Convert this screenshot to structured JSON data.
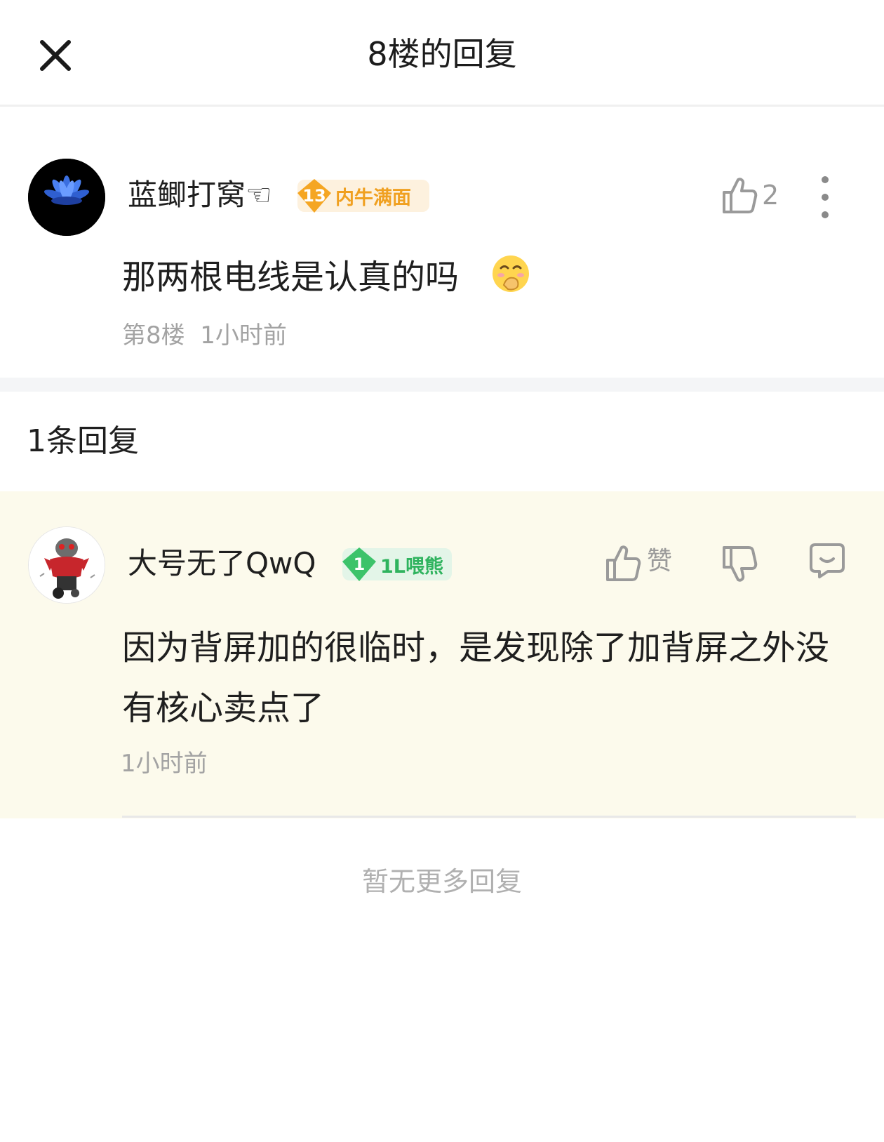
{
  "header": {
    "title": "8楼的回复",
    "close_icon": "close-icon"
  },
  "main_comment": {
    "username": "蓝鲫打窝☜",
    "badge_level": "13",
    "badge_title": "内牛满面",
    "badge_color": "#f5a623",
    "like_count": "2",
    "text": "那两根电线是认真的吗",
    "emoji": "hand-over-mouth-emoji",
    "floor": "第8楼",
    "time": "1小时前",
    "icons": [
      "thumbs-up-icon",
      "more-vertical-icon"
    ]
  },
  "replies_section": {
    "count_label": "1条回复",
    "replies": [
      {
        "username": "大号无了QwQ",
        "badge_level": "1",
        "badge_title": "1L喂熊",
        "badge_color": "#3cc36a",
        "like_label": "赞",
        "text": "因为背屏加的很临时，是发现除了加背屏之外没有核心卖点了",
        "time": "1小时前",
        "icons": [
          "thumbs-up-icon",
          "thumbs-down-icon",
          "reply-icon"
        ]
      }
    ],
    "end_label": "暂无更多回复"
  }
}
